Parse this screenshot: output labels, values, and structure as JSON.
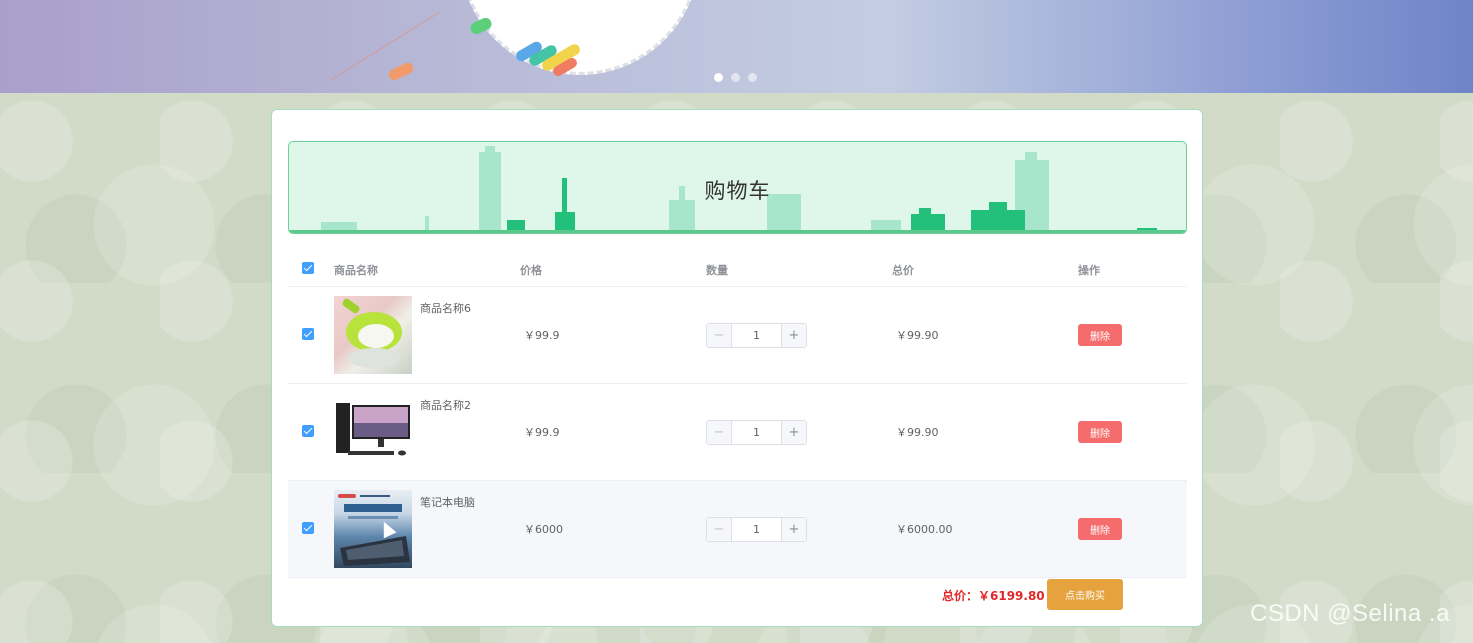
{
  "banner": {
    "carousel_dots": 3,
    "active_dot": 0
  },
  "cart": {
    "title": "购物车",
    "columns": {
      "name": "商品名称",
      "price": "价格",
      "quantity": "数量",
      "total": "总价",
      "actions": "操作"
    },
    "items": [
      {
        "name": "商品名称6",
        "price": "￥99.9",
        "quantity": "1",
        "total": "￥99.90",
        "delete_label": "删除",
        "checked": true,
        "thumb_icon": "green-bowl-image"
      },
      {
        "name": "商品名称2",
        "price": "￥99.9",
        "quantity": "1",
        "total": "￥99.90",
        "delete_label": "删除",
        "checked": true,
        "thumb_icon": "desktop-computer-image"
      },
      {
        "name": "笔记本电脑",
        "price": "￥6000",
        "quantity": "1",
        "total": "￥6000.00",
        "delete_label": "删除",
        "checked": true,
        "thumb_icon": "laptop-poster-image"
      }
    ],
    "grand_total": "总价：￥6199.80",
    "buy_label": "点击购买",
    "stepper_minus": "−",
    "stepper_plus": "+"
  },
  "watermark": "CSDN @Selina .a",
  "colors": {
    "checkbox": "#409eff",
    "delete": "#f56c6c",
    "buy": "#e6a23c",
    "total_text": "#e02828",
    "header_panel": "#dff7ea"
  }
}
